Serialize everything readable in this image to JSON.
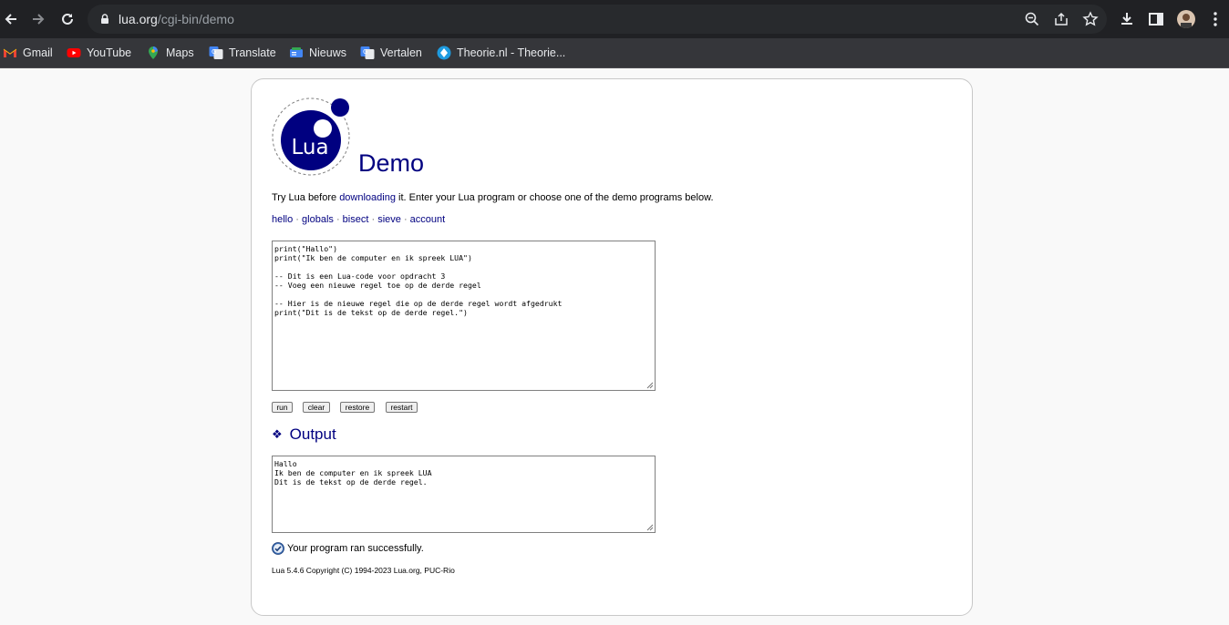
{
  "browser": {
    "url_host": "lua.org",
    "url_path": "/cgi-bin/demo"
  },
  "bookmarks": [
    {
      "label": "Gmail",
      "icon": "gmail-icon"
    },
    {
      "label": "YouTube",
      "icon": "youtube-icon"
    },
    {
      "label": "Maps",
      "icon": "maps-icon"
    },
    {
      "label": "Translate",
      "icon": "translate-icon"
    },
    {
      "label": "Nieuws",
      "icon": "news-icon"
    },
    {
      "label": "Vertalen",
      "icon": "translate-icon"
    },
    {
      "label": "Theorie.nl - Theorie...",
      "icon": "theorie-icon"
    }
  ],
  "page": {
    "logo_text": "Lua",
    "title": "Demo",
    "intro_before": "Try Lua before ",
    "intro_link": "downloading",
    "intro_after": " it. Enter your Lua program or choose one of the demo programs below.",
    "demos": [
      "hello",
      "globals",
      "bisect",
      "sieve",
      "account"
    ],
    "demo_separator": " · ",
    "code": "print(\"Hallo\")\nprint(\"Ik ben de computer en ik spreek LUA\")\n\n-- Dit is een Lua-code voor opdracht 3\n-- Voeg een nieuwe regel toe op de derde regel\n\n-- Hier is de nieuwe regel die op de derde regel wordt afgedrukt\nprint(\"Dit is de tekst op de derde regel.\")",
    "buttons": {
      "run": "run",
      "clear": "clear",
      "restore": "restore",
      "restart": "restart"
    },
    "output_heading_icon": "❖",
    "output_heading": "Output",
    "output": "Hallo\nIk ben de computer en ik spreek LUA\nDit is de tekst op de derde regel.",
    "status": "Your program ran successfully.",
    "footer": "Lua 5.4.6 Copyright (C) 1994-2023 Lua.org, PUC-Rio"
  },
  "colors": {
    "lua_blue": "#000080",
    "chrome_dark": "#202124",
    "bookmarks_bar": "#35363a"
  }
}
